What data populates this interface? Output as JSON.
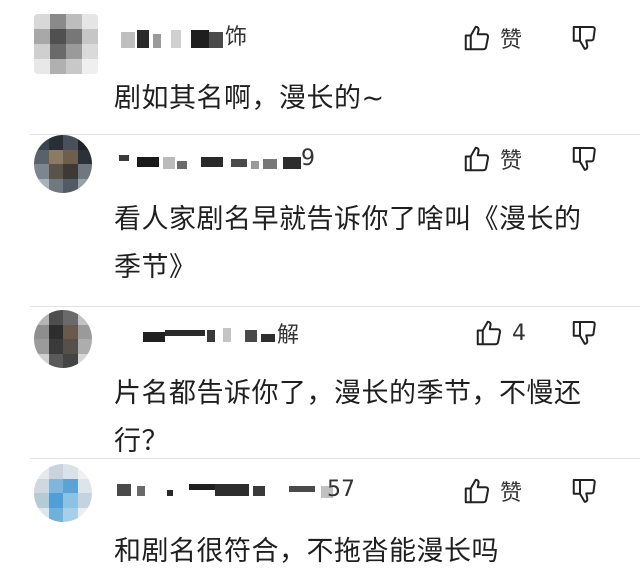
{
  "comments": [
    {
      "name_tail": "饰",
      "like_label": "赞",
      "text": "剧如其名啊，漫长的~"
    },
    {
      "name_tail": "9",
      "like_label": "赞",
      "text_line1": "看人家剧名早就告诉你了啥叫《漫长的",
      "text_line2": "季节》"
    },
    {
      "name_tail": "解",
      "like_label": "4",
      "text_line1": "片名都告诉你了，漫长的季节，不慢还",
      "text_line2": "行？"
    },
    {
      "name_tail": "57",
      "like_label": "赞",
      "text": "和剧名很符合，不拖沓能漫长吗"
    }
  ],
  "icons": {
    "like": "thumbs-up-icon",
    "dislike": "thumbs-down-icon"
  }
}
